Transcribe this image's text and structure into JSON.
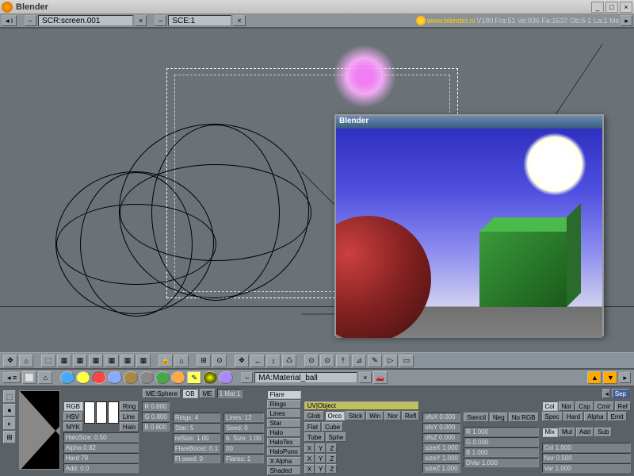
{
  "titlebar": {
    "title": "Blender"
  },
  "infobar": {
    "screen": "SCR:screen.001",
    "scene": "SCE:1",
    "url": "www.blender.nl",
    "version": "V180",
    "stats": "Fra:51  Ve:936 Fa:1637  Ob:6-1 La:1  Me"
  },
  "render_window": {
    "title": "Blender"
  },
  "toolbar1_icons": [
    "✥",
    "⌂",
    "⬚",
    "▦",
    "▦",
    "▦",
    "▦",
    "▦",
    "▦",
    "🔒",
    "⌂",
    "⊞",
    "⊙",
    "✥",
    "↔",
    "↕",
    "♺",
    "⊙",
    "⊙",
    "⫯",
    "⊿",
    "✎",
    "▷",
    "▭"
  ],
  "shade_row": {
    "material_field": "MA:Material_ball"
  },
  "props": {
    "header": {
      "mesh_name": "ME:Sphere",
      "ob_btn": "OB",
      "me_btn": "ME",
      "mat_count": "1 Mat 1",
      "sep_btn": "Sep"
    },
    "preview_btns": [
      "⬚",
      "●",
      "◐",
      "⊞"
    ],
    "color_modes": [
      "RGB",
      "HSV",
      "MYK"
    ],
    "swatch_labels": [
      "Ring",
      "Line",
      "Halo"
    ],
    "rgb_vals": [
      "R 0.800",
      "G 0.800",
      "B 0.800"
    ],
    "halo_section": {
      "size": "HaloSize: 0.50",
      "alpha": "Alpha 0.82",
      "hard": "Hard 79",
      "add": "Add: 0.0"
    },
    "rings_col": [
      "Rings: 4",
      "Star: 5",
      "reSize: 1.00",
      "FlareBoost: 0.1",
      "Fl.seed: 0"
    ],
    "lines_col": [
      "Lines: 12",
      "Seed: 0",
      "b. Size: 1.00",
      "00",
      "Flares: 1"
    ],
    "flare_col": [
      "Flare",
      "Rings",
      "Lines",
      "Star",
      "Halo",
      "HaloTex",
      "HaloPuno",
      "X Alpha",
      "Shaded"
    ],
    "uv_section": {
      "header": "UV|Object",
      "row1": [
        "Glob",
        "Orco",
        "Stick",
        "Win",
        "Nor",
        "Refl"
      ],
      "row2": [
        "Flat",
        "Cube"
      ],
      "row3": [
        "Tube",
        "Sphe"
      ],
      "xyz": [
        "X",
        "Y",
        "Z"
      ]
    },
    "ofs_col": [
      "ofsX 0.000",
      "ofsY 0.000",
      "ofsZ 0.000",
      "sizeX 1.000",
      "sizeY 1.000",
      "sizeZ 1.000"
    ],
    "stencil_row": [
      "Stencil",
      "Neg",
      "No RGB"
    ],
    "rgb2": [
      "R 1.000",
      "G 0.000",
      "B 1.000",
      "DVar 1.000"
    ],
    "col_toggles_top": [
      "Col",
      "Nor",
      "Csp",
      "Cmir",
      "Ref"
    ],
    "col_toggles_bot": [
      "Spec",
      "Hard",
      "Alpha",
      "Emit"
    ],
    "mix_row": [
      "Mix",
      "Mul",
      "Add",
      "Sub"
    ],
    "end_col": [
      "Col 1.000",
      "Nor 0.500",
      "Var 1.000"
    ]
  }
}
